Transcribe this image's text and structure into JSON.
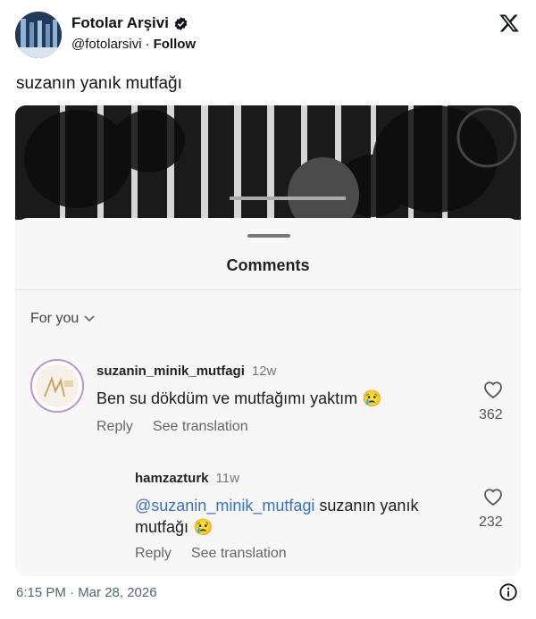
{
  "author": {
    "name": "Fotolar Arşivi",
    "handle": "@fotolarsivi",
    "separator": "·",
    "follow_label": "Follow"
  },
  "tweet": {
    "text": "suzanın yanık mutfağı",
    "timestamp": "6:15 PM · Mar 28, 2026"
  },
  "embedded": {
    "title": "Comments",
    "filter_label": "For you",
    "comments": [
      {
        "username": "suzanin_minik_mutfagi",
        "time": "12w",
        "text": "Ben su dökdüm ve mutfağımı yaktım 😢",
        "reply_label": "Reply",
        "translate_label": "See translation",
        "likes": "362"
      },
      {
        "username": "hamzazturk",
        "time": "11w",
        "mention": "@suzanin_minik_mutfagi",
        "text_after": " suzanın yanık",
        "text_line2": "mutfağı 😢",
        "reply_label": "Reply",
        "translate_label": "See translation",
        "likes": "232"
      }
    ]
  },
  "icons": {
    "verified": "verified-badge-icon",
    "x_logo": "x-logo-icon",
    "info": "info-icon",
    "heart": "heart-icon",
    "chevron": "chevron-down-icon"
  }
}
